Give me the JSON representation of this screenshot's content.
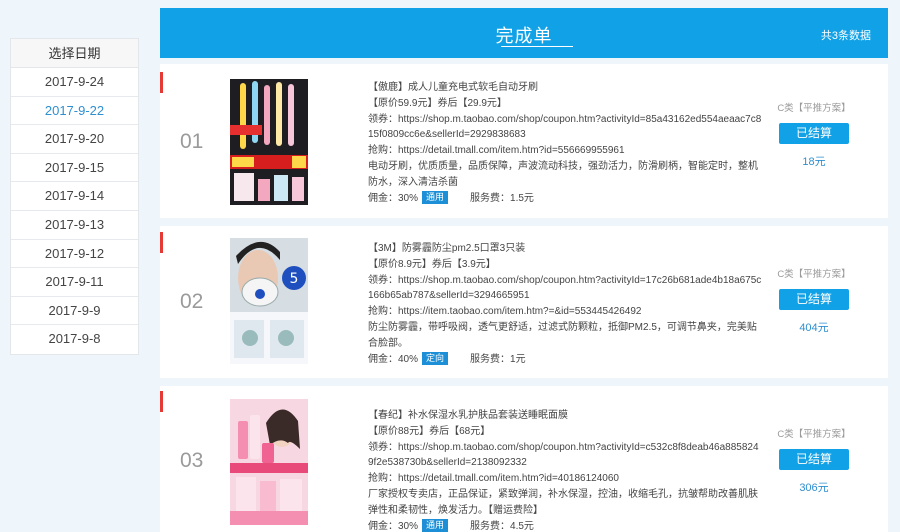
{
  "sidebar": {
    "header": "选择日期",
    "items": [
      {
        "label": "2017-9-24",
        "active": false
      },
      {
        "label": "2017-9-22",
        "active": true
      },
      {
        "label": "2017-9-20",
        "active": false
      },
      {
        "label": "2017-9-15",
        "active": false
      },
      {
        "label": "2017-9-14",
        "active": false
      },
      {
        "label": "2017-9-13",
        "active": false
      },
      {
        "label": "2017-9-12",
        "active": false
      },
      {
        "label": "2017-9-11",
        "active": false
      },
      {
        "label": "2017-9-9",
        "active": false
      },
      {
        "label": "2017-9-8",
        "active": false
      }
    ]
  },
  "topbar": {
    "title": "完成单",
    "count": "共3条数据"
  },
  "colors": {
    "accent": "#11a1e6",
    "mark": "#e53935",
    "link": "#2f8fd0"
  },
  "orders": [
    {
      "num": "01",
      "title": "【傲鹿】成人儿童充电式软毛自动牙刷",
      "price": "【原价59.9元】券后【29.9元】",
      "coupon": "领券：https://shop.m.taobao.com/shop/coupon.htm?activityId=85a43162ed554aeaac7c815f0809cc6e&sellerId=2929838683",
      "buy": "抢购：https://detail.tmall.com/item.htm?id=556669955961",
      "desc": "电动牙刷，优质质量，品质保障，声波流动科技，强劲活力，防滑刷柄，智能定时，整机防水，深入清洁杀菌",
      "commission": "佣金：30%",
      "tag": "通用",
      "fee": "服务费：1.5元",
      "category": "C类【平推方案】",
      "button": "已结算",
      "amount": "18元"
    },
    {
      "num": "02",
      "title": "【3M】防雾霾防尘pm2.5口罩3只装",
      "price": "【原价8.9元】券后【3.9元】",
      "coupon": "领券：https://shop.m.taobao.com/shop/coupon.htm?activityId=17c26b681ade4b18a675c166b65ab787&sellerId=3294665951",
      "buy": "抢购：https://item.taobao.com/item.htm?=&id=553445426492",
      "desc": "防尘防雾霾，带呼吸阀，透气更舒适，过滤式防颗粒，抵御PM2.5，可调节鼻夹，完美贴合脸部。",
      "commission": "佣金：40%",
      "tag": "定向",
      "fee": "服务费：1元",
      "category": "C类【平推方案】",
      "button": "已结算",
      "amount": "404元"
    },
    {
      "num": "03",
      "title": "【春纪】补水保湿水乳护肤品套装送睡眠面膜",
      "price": "【原价88元】券后【68元】",
      "coupon": "领券：https://shop.m.taobao.com/shop/coupon.htm?activityId=c532c8f8deab46a8858249f2e538730b&sellerId=2138092332",
      "buy": "抢购：https://detail.tmall.com/item.htm?id=40186124060",
      "desc": "厂家授权专卖店，正品保证，紧致弹润，补水保湿，控油，收缩毛孔，抗皱帮助改善肌肤弹性和柔韧性，焕发活力。【赠运费险】",
      "commission": "佣金：30%",
      "tag": "通用",
      "fee": "服务费：4.5元",
      "category": "C类【平推方案】",
      "button": "已结算",
      "amount": "306元"
    }
  ]
}
